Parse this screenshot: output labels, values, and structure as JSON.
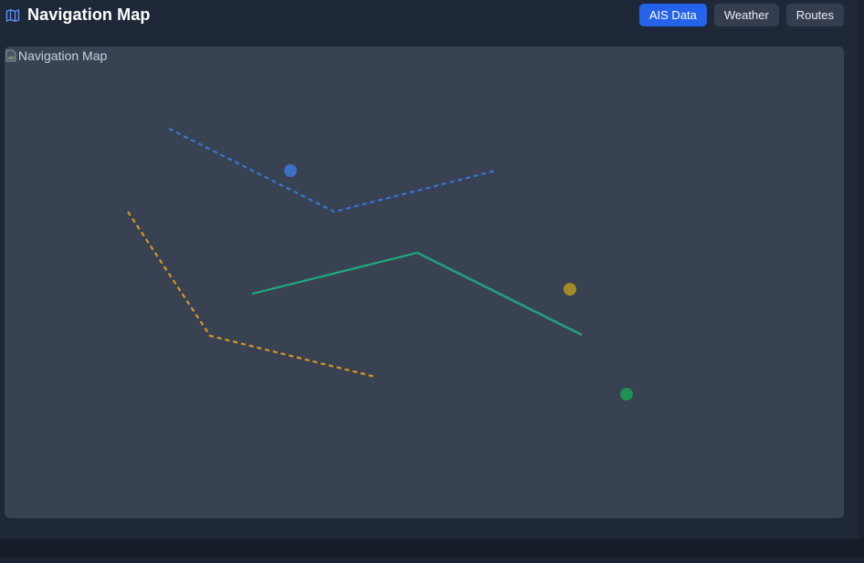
{
  "header": {
    "title": "Navigation Map",
    "title_icon": "map-icon"
  },
  "toolbar": {
    "buttons": [
      {
        "label": "AIS Data",
        "active": true
      },
      {
        "label": "Weather",
        "active": false
      },
      {
        "label": "Routes",
        "active": false
      }
    ]
  },
  "map": {
    "image_alt": "Navigation Map",
    "broken_image_icon": "broken-image-icon",
    "routes": [
      {
        "name": "route-blue",
        "color": "#3b73d6",
        "style": "dashed"
      },
      {
        "name": "route-orange",
        "color": "#d9971e",
        "style": "dashed"
      },
      {
        "name": "route-green",
        "color": "#22a37a",
        "style": "solid"
      }
    ],
    "markers": [
      {
        "name": "vessel-marker-blue",
        "color": "#3d6fc4"
      },
      {
        "name": "vessel-marker-yellow",
        "color": "#a18a27"
      },
      {
        "name": "vessel-marker-green",
        "color": "#1f9153"
      }
    ]
  },
  "colors": {
    "accent": "#2563eb",
    "panel": "#1f2838",
    "map_bg": "#384252"
  }
}
